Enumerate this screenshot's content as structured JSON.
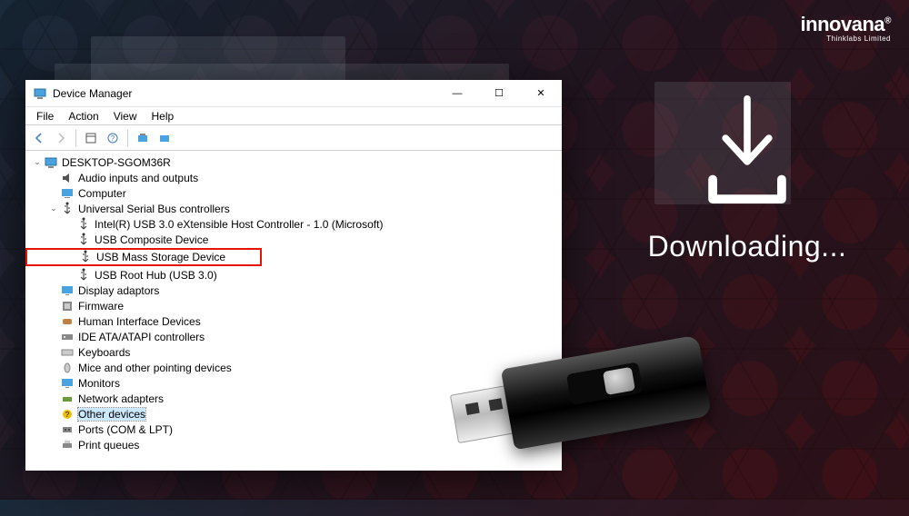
{
  "brand": {
    "name": "innovana",
    "sub": "Thinklabs Limited",
    "mark": "®"
  },
  "window": {
    "title": "Device Manager",
    "controls": {
      "min": "—",
      "max": "☐",
      "close": "✕"
    }
  },
  "menus": [
    "File",
    "Action",
    "View",
    "Help"
  ],
  "tree": {
    "root": "DESKTOP-SGOM36R",
    "nodes": [
      {
        "label": "Audio inputs and outputs",
        "icon": "audio"
      },
      {
        "label": "Computer",
        "icon": "computer"
      },
      {
        "label": "Universal Serial Bus controllers",
        "icon": "usb",
        "expanded": true,
        "children": [
          {
            "label": "Intel(R) USB 3.0 eXtensible Host Controller - 1.0 (Microsoft)",
            "icon": "usb"
          },
          {
            "label": "USB Composite Device",
            "icon": "usb"
          },
          {
            "label": "USB Mass Storage Device",
            "icon": "usb",
            "highlight": true
          },
          {
            "label": "USB Root Hub (USB 3.0)",
            "icon": "usb"
          }
        ]
      },
      {
        "label": "Display adaptors",
        "icon": "display"
      },
      {
        "label": "Firmware",
        "icon": "firmware"
      },
      {
        "label": "Human Interface Devices",
        "icon": "hid"
      },
      {
        "label": "IDE ATA/ATAPI controllers",
        "icon": "ide"
      },
      {
        "label": "Keyboards",
        "icon": "keyboard"
      },
      {
        "label": "Mice and other pointing devices",
        "icon": "mouse"
      },
      {
        "label": "Monitors",
        "icon": "monitor"
      },
      {
        "label": "Network adapters",
        "icon": "network"
      },
      {
        "label": "Other devices",
        "icon": "other",
        "selected": true
      },
      {
        "label": "Ports (COM & LPT)",
        "icon": "port"
      },
      {
        "label": "Print queues",
        "icon": "printer"
      }
    ]
  },
  "download_text": "Downloading..."
}
